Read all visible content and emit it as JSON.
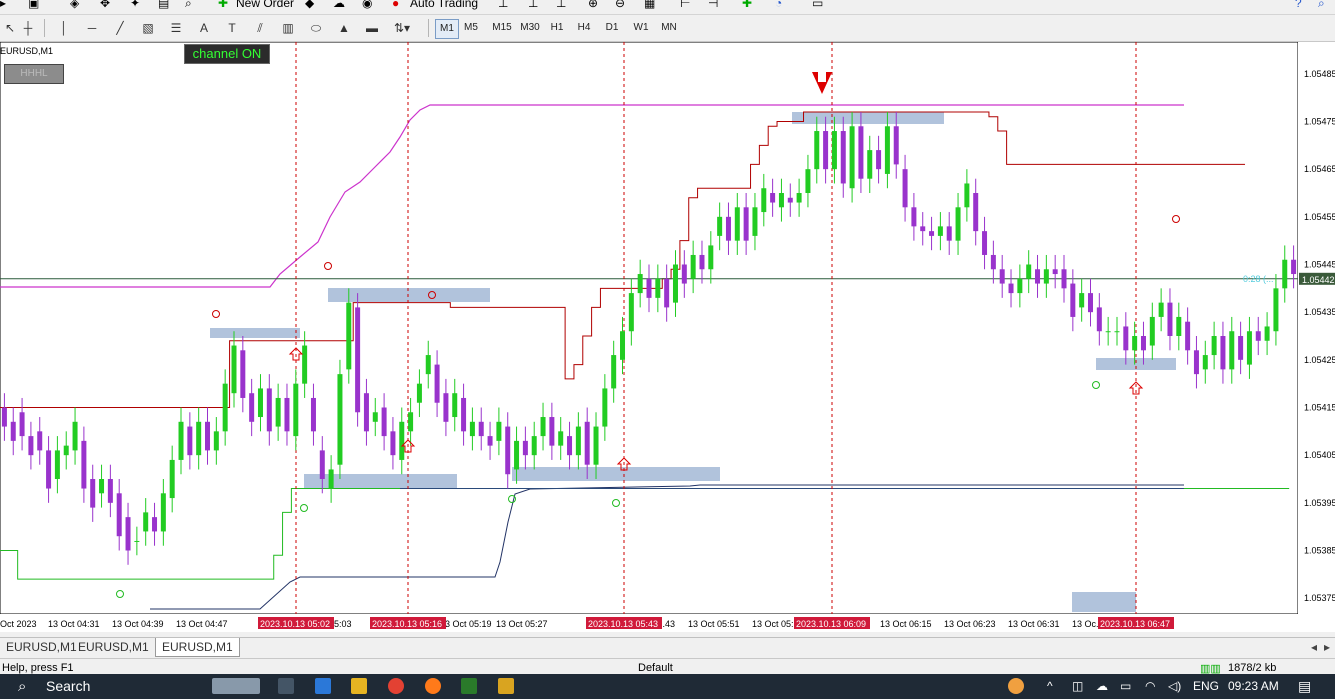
{
  "toolbar_top": {
    "new_order_label": "New Order",
    "auto_trading_label": "Auto Trading"
  },
  "timeframes": [
    {
      "label": "M1",
      "active": true
    },
    {
      "label": "M5"
    },
    {
      "label": "M15"
    },
    {
      "label": "M30"
    },
    {
      "label": "H1"
    },
    {
      "label": "H4"
    },
    {
      "label": "D1"
    },
    {
      "label": "W1"
    },
    {
      "label": "MN"
    }
  ],
  "chart": {
    "symbol_label": "EURUSD,M1",
    "channel_button": "channel ON",
    "hhhl_button": "HHHL",
    "current_price_label": "1.05442",
    "countdown_label": "0:28 (...",
    "colors": {
      "bull": "#22cc22",
      "bear": "#9933cc",
      "resistance": "#b00000",
      "support": "#22bb22",
      "upper_band": "#cc33cc",
      "lower_band": "#223366",
      "zone": "#a8bcd8",
      "signal": "#dd0000"
    },
    "price_ticks": [
      "1.05485",
      "1.05475",
      "1.05465",
      "1.05455",
      "1.05445",
      "1.05435",
      "1.05425",
      "1.05415",
      "1.05405",
      "1.05395",
      "1.05385",
      "1.05375"
    ],
    "time_ticks": [
      "Oct 2023",
      "13 Oct 04:31",
      "13 Oct 04:39",
      "13 Oct 04:47",
      "13 Oct 05:03",
      "13 Oct 05:19",
      "13 Oct 05:27",
      "13 Oct 05:...43",
      "13 Oct 05:51",
      "13 Oct 05:...",
      "13 Oct 06:15",
      "13 Oct 06:23",
      "13 Oct 06:31",
      "13 Oc...",
      "...:47"
    ],
    "marker_labels": [
      "2023.10.13 05:02",
      "2023.10.13 05:16",
      "2023.10.13 05:43",
      "2023.10.13 06:09",
      "2023.10.13 06:47"
    ]
  },
  "chart_data": {
    "type": "candlestick",
    "symbol": "EURUSD",
    "timeframe": "M1",
    "ylim": [
      1.0537,
      1.0549
    ],
    "candles": [
      {
        "o": 1.05415,
        "c": 1.05411
      },
      {
        "o": 1.05412,
        "c": 1.05408
      },
      {
        "o": 1.05414,
        "c": 1.05409
      },
      {
        "o": 1.05409,
        "c": 1.05405
      },
      {
        "o": 1.0541,
        "c": 1.05406
      },
      {
        "o": 1.05406,
        "c": 1.05398
      },
      {
        "o": 1.054,
        "c": 1.05406
      },
      {
        "o": 1.05405,
        "c": 1.05407
      },
      {
        "o": 1.05406,
        "c": 1.05412
      },
      {
        "o": 1.05408,
        "c": 1.05398
      },
      {
        "o": 1.054,
        "c": 1.05394
      },
      {
        "o": 1.05397,
        "c": 1.054
      },
      {
        "o": 1.054,
        "c": 1.05395
      },
      {
        "o": 1.05397,
        "c": 1.05388
      },
      {
        "o": 1.05392,
        "c": 1.05385
      },
      {
        "o": 1.05387,
        "c": 1.05387
      },
      {
        "o": 1.05389,
        "c": 1.05393
      },
      {
        "o": 1.05392,
        "c": 1.05389
      },
      {
        "o": 1.05389,
        "c": 1.05397
      },
      {
        "o": 1.05396,
        "c": 1.05404
      },
      {
        "o": 1.05404,
        "c": 1.05412
      },
      {
        "o": 1.05411,
        "c": 1.05405
      },
      {
        "o": 1.05405,
        "c": 1.05412
      },
      {
        "o": 1.05412,
        "c": 1.05406
      },
      {
        "o": 1.05406,
        "c": 1.0541
      },
      {
        "o": 1.0541,
        "c": 1.0542
      },
      {
        "o": 1.05418,
        "c": 1.05428
      },
      {
        "o": 1.05427,
        "c": 1.05417
      },
      {
        "o": 1.05418,
        "c": 1.05412
      },
      {
        "o": 1.05413,
        "c": 1.05419
      },
      {
        "o": 1.05419,
        "c": 1.0541
      },
      {
        "o": 1.05411,
        "c": 1.05417
      },
      {
        "o": 1.05417,
        "c": 1.0541
      },
      {
        "o": 1.05409,
        "c": 1.0542
      },
      {
        "o": 1.0542,
        "c": 1.05428
      },
      {
        "o": 1.05417,
        "c": 1.0541
      },
      {
        "o": 1.05406,
        "c": 1.054
      },
      {
        "o": 1.05398,
        "c": 1.05402
      },
      {
        "o": 1.05403,
        "c": 1.05422
      },
      {
        "o": 1.05423,
        "c": 1.05437
      },
      {
        "o": 1.05436,
        "c": 1.05414
      },
      {
        "o": 1.05418,
        "c": 1.0541
      },
      {
        "o": 1.05412,
        "c": 1.05414
      },
      {
        "o": 1.05415,
        "c": 1.05409
      },
      {
        "o": 1.0541,
        "c": 1.05405
      },
      {
        "o": 1.05404,
        "c": 1.05412
      },
      {
        "o": 1.0541,
        "c": 1.05414
      },
      {
        "o": 1.05416,
        "c": 1.0542
      },
      {
        "o": 1.05422,
        "c": 1.05426
      },
      {
        "o": 1.05424,
        "c": 1.05416
      },
      {
        "o": 1.05418,
        "c": 1.05412
      },
      {
        "o": 1.05413,
        "c": 1.05418
      },
      {
        "o": 1.05417,
        "c": 1.0541
      },
      {
        "o": 1.05409,
        "c": 1.05412
      },
      {
        "o": 1.05412,
        "c": 1.05409
      },
      {
        "o": 1.05409,
        "c": 1.05407
      },
      {
        "o": 1.05408,
        "c": 1.05412
      },
      {
        "o": 1.05411,
        "c": 1.05401
      },
      {
        "o": 1.05402,
        "c": 1.05408
      },
      {
        "o": 1.05408,
        "c": 1.05405
      },
      {
        "o": 1.05405,
        "c": 1.05409
      },
      {
        "o": 1.05409,
        "c": 1.05413
      },
      {
        "o": 1.05413,
        "c": 1.05407
      },
      {
        "o": 1.05407,
        "c": 1.0541
      },
      {
        "o": 1.05409,
        "c": 1.05405
      },
      {
        "o": 1.05405,
        "c": 1.05411
      },
      {
        "o": 1.05412,
        "c": 1.05403
      },
      {
        "o": 1.05403,
        "c": 1.05411
      },
      {
        "o": 1.05411,
        "c": 1.05419
      },
      {
        "o": 1.05419,
        "c": 1.05426
      },
      {
        "o": 1.05425,
        "c": 1.05431
      },
      {
        "o": 1.05431,
        "c": 1.05439
      },
      {
        "o": 1.05439,
        "c": 1.05443
      },
      {
        "o": 1.05442,
        "c": 1.05438
      },
      {
        "o": 1.05438,
        "c": 1.05442
      },
      {
        "o": 1.05442,
        "c": 1.05436
      },
      {
        "o": 1.05437,
        "c": 1.05445
      },
      {
        "o": 1.05445,
        "c": 1.05441
      },
      {
        "o": 1.05442,
        "c": 1.05447
      },
      {
        "o": 1.05447,
        "c": 1.05444
      },
      {
        "o": 1.05444,
        "c": 1.05449
      },
      {
        "o": 1.05451,
        "c": 1.05455
      },
      {
        "o": 1.05455,
        "c": 1.0545
      },
      {
        "o": 1.0545,
        "c": 1.05457
      },
      {
        "o": 1.05457,
        "c": 1.0545
      },
      {
        "o": 1.05451,
        "c": 1.05457
      },
      {
        "o": 1.05456,
        "c": 1.05461
      },
      {
        "o": 1.0546,
        "c": 1.05458
      },
      {
        "o": 1.05457,
        "c": 1.0546
      },
      {
        "o": 1.05459,
        "c": 1.05458
      },
      {
        "o": 1.05458,
        "c": 1.0546
      },
      {
        "o": 1.0546,
        "c": 1.05465
      },
      {
        "o": 1.05465,
        "c": 1.05473
      },
      {
        "o": 1.05473,
        "c": 1.05465
      },
      {
        "o": 1.05465,
        "c": 1.05473
      },
      {
        "o": 1.05473,
        "c": 1.05462
      },
      {
        "o": 1.05461,
        "c": 1.05474
      },
      {
        "o": 1.05474,
        "c": 1.05463
      },
      {
        "o": 1.05463,
        "c": 1.05469
      },
      {
        "o": 1.05469,
        "c": 1.05465
      },
      {
        "o": 1.05464,
        "c": 1.05474
      },
      {
        "o": 1.05474,
        "c": 1.05466
      },
      {
        "o": 1.05465,
        "c": 1.05457
      },
      {
        "o": 1.05457,
        "c": 1.05453
      },
      {
        "o": 1.05453,
        "c": 1.05452
      },
      {
        "o": 1.05452,
        "c": 1.05451
      },
      {
        "o": 1.05451,
        "c": 1.05453
      },
      {
        "o": 1.05453,
        "c": 1.0545
      },
      {
        "o": 1.0545,
        "c": 1.05457
      },
      {
        "o": 1.05457,
        "c": 1.05462
      },
      {
        "o": 1.0546,
        "c": 1.05452
      },
      {
        "o": 1.05452,
        "c": 1.05447
      },
      {
        "o": 1.05447,
        "c": 1.05444
      },
      {
        "o": 1.05444,
        "c": 1.05441
      },
      {
        "o": 1.05441,
        "c": 1.05439
      },
      {
        "o": 1.05439,
        "c": 1.05442
      },
      {
        "o": 1.05442,
        "c": 1.05445
      },
      {
        "o": 1.05444,
        "c": 1.05441
      },
      {
        "o": 1.05441,
        "c": 1.05444
      },
      {
        "o": 1.05444,
        "c": 1.05443
      },
      {
        "o": 1.05444,
        "c": 1.0544
      },
      {
        "o": 1.05441,
        "c": 1.05434
      },
      {
        "o": 1.05436,
        "c": 1.05439
      },
      {
        "o": 1.05439,
        "c": 1.05435
      },
      {
        "o": 1.05436,
        "c": 1.05431
      },
      {
        "o": 1.05431,
        "c": 1.05431
      },
      {
        "o": 1.05431,
        "c": 1.05431
      },
      {
        "o": 1.05432,
        "c": 1.05427
      },
      {
        "o": 1.05427,
        "c": 1.0543
      },
      {
        "o": 1.0543,
        "c": 1.05427
      },
      {
        "o": 1.05428,
        "c": 1.05434
      },
      {
        "o": 1.05434,
        "c": 1.05437
      },
      {
        "o": 1.05437,
        "c": 1.0543
      },
      {
        "o": 1.0543,
        "c": 1.05434
      },
      {
        "o": 1.05433,
        "c": 1.05427
      },
      {
        "o": 1.05427,
        "c": 1.05422
      },
      {
        "o": 1.05423,
        "c": 1.05426
      },
      {
        "o": 1.05426,
        "c": 1.0543
      },
      {
        "o": 1.0543,
        "c": 1.05423
      },
      {
        "o": 1.05423,
        "c": 1.05431
      },
      {
        "o": 1.0543,
        "c": 1.05425
      },
      {
        "o": 1.05424,
        "c": 1.05431
      },
      {
        "o": 1.05431,
        "c": 1.05429
      },
      {
        "o": 1.05429,
        "c": 1.05432
      },
      {
        "o": 1.05431,
        "c": 1.0544
      },
      {
        "o": 1.0544,
        "c": 1.05446
      },
      {
        "o": 1.05446,
        "c": 1.05443
      }
    ],
    "resistance_line": [
      1.05415,
      1.05415,
      1.05415,
      1.05415,
      1.05415,
      1.05415,
      1.05415,
      1.05415,
      1.05415,
      1.05415,
      1.05415,
      1.05415,
      1.05415,
      1.05415,
      1.05415,
      1.05415,
      1.05415,
      1.05415,
      1.05415,
      1.05415,
      1.05415,
      1.05415,
      1.05415,
      1.05415,
      1.05415,
      1.05415,
      1.05429,
      1.05429,
      1.05429,
      1.05429,
      1.05429,
      1.05429,
      1.05429,
      1.05429,
      1.05429,
      1.05429,
      1.05429,
      1.05429,
      1.05429,
      1.05429,
      1.05437,
      1.05437,
      1.05437,
      1.05437,
      1.05437,
      1.05437,
      1.05437,
      1.05437,
      1.05437,
      1.05437,
      1.05437,
      1.05436,
      1.05436,
      1.05436,
      1.05436,
      1.05436,
      1.05436,
      1.05436,
      1.05436,
      1.05436,
      1.05436,
      1.05436,
      1.05436,
      1.05436,
      1.05421,
      1.05424,
      1.0543,
      1.05436,
      1.0544,
      1.0544,
      1.0544,
      1.0544,
      1.0544,
      1.0544,
      1.0544,
      1.05442,
      1.05444,
      1.0545,
      1.05459,
      1.05461,
      1.05461,
      1.05461,
      1.05461,
      1.05461,
      1.05461,
      1.05466,
      1.0547,
      1.05474,
      1.05475,
      1.05475,
      1.05475,
      1.05477,
      1.05477,
      1.05477,
      1.05477,
      1.05477,
      1.05477,
      1.05477,
      1.05477,
      1.05477,
      1.05477,
      1.05477,
      1.05477,
      1.05477,
      1.05477,
      1.05477,
      1.05477,
      1.05477,
      1.05477,
      1.05477,
      1.05477,
      1.05477,
      1.05476,
      1.05473,
      1.05466,
      1.05466,
      1.05466,
      1.05466,
      1.05466,
      1.05466,
      1.05466,
      1.05466,
      1.05466,
      1.05466,
      1.05466,
      1.05466,
      1.05466,
      1.05466,
      1.05466,
      1.05466,
      1.05466,
      1.05466,
      1.05466,
      1.05466,
      1.05466,
      1.05466,
      1.05466,
      1.05466,
      1.05466,
      1.05466,
      1.05466
    ],
    "support_line": [
      1.05385,
      1.05385,
      1.05379,
      1.05379,
      1.05379,
      1.05379,
      1.05379,
      1.05379,
      1.05379,
      1.05379,
      1.05379,
      1.05379,
      1.05379,
      1.05379,
      1.05379,
      1.05379,
      1.05379,
      1.05379,
      1.05379,
      1.05379,
      1.05379,
      1.05379,
      1.05379,
      1.05379,
      1.05379,
      1.05379,
      1.05379,
      1.05379,
      1.05379,
      1.05379,
      1.05379,
      1.05384,
      1.05393,
      1.05398,
      1.05398,
      1.05398,
      1.05398,
      1.05398,
      1.05398,
      1.05398,
      1.05398,
      1.05398,
      1.05398,
      1.05398,
      1.05398,
      1.05398,
      1.05398,
      1.05398,
      1.05398,
      1.05398,
      1.05398,
      1.05398,
      1.05398,
      1.05398,
      1.05398,
      1.05398,
      1.05398,
      1.05398,
      1.05398,
      1.05398,
      1.05398,
      1.05398,
      1.05398,
      1.05398,
      1.05398,
      1.05398,
      1.05398,
      1.05398,
      1.05398,
      1.05398,
      1.05398,
      1.05398,
      1.05398,
      1.05398,
      1.05398,
      1.05398,
      1.05398,
      1.05398,
      1.05398,
      1.05398,
      1.05398,
      1.05398,
      1.05398,
      1.05398,
      1.05398,
      1.05398,
      1.05398,
      1.05398,
      1.05398,
      1.05398,
      1.05398,
      1.05398,
      1.05398,
      1.05398,
      1.05398,
      1.05398,
      1.05398,
      1.05398,
      1.05398,
      1.05398,
      1.05398,
      1.05398,
      1.05398,
      1.05398,
      1.05398,
      1.05398,
      1.05398,
      1.05398,
      1.05398,
      1.05398,
      1.05398,
      1.05398,
      1.05398,
      1.05398,
      1.05398,
      1.05398,
      1.05398,
      1.05398,
      1.05398,
      1.05398,
      1.05398,
      1.05398,
      1.05398,
      1.05398,
      1.05398,
      1.05398,
      1.05398,
      1.05398,
      1.05398,
      1.05398,
      1.05398,
      1.05398,
      1.05398,
      1.05398,
      1.05398,
      1.05398,
      1.05398,
      1.05398,
      1.05398,
      1.05398,
      1.05398,
      1.05398,
      1.05398,
      1.05398,
      1.05398,
      1.05398
    ],
    "levels": {
      "current": 1.05442,
      "hline_low": 1.05398
    }
  }
}
